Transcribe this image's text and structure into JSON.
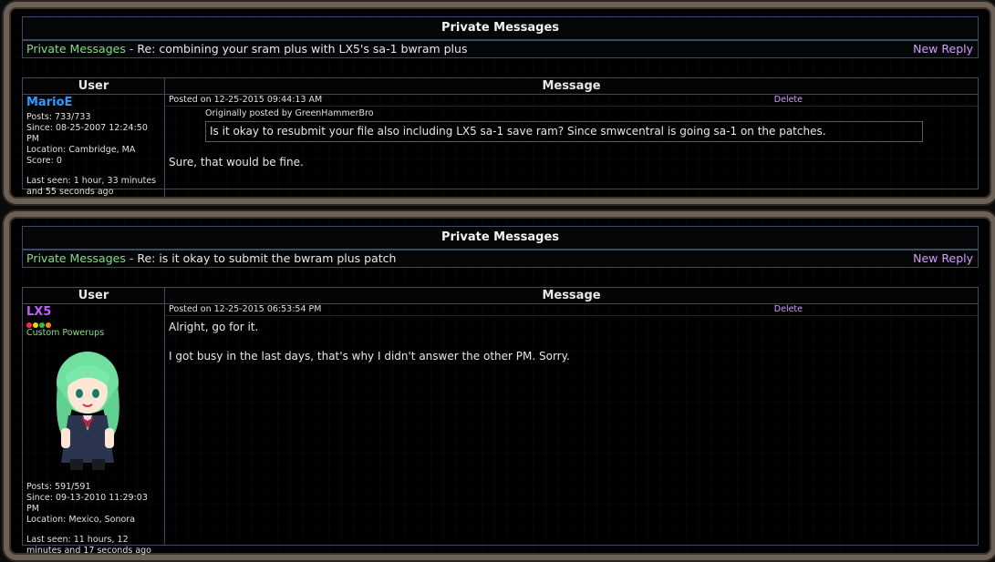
{
  "threads": [
    {
      "title": "Private Messages",
      "breadcrumb": {
        "link": "Private Messages",
        "separator": " - ",
        "subject": "Re: combining your sram plus with LX5's sa-1 bwram plus"
      },
      "new_reply": "New Reply",
      "headers": {
        "user": "User",
        "message": "Message"
      },
      "post": {
        "username": "MarioE",
        "posts": "Posts: 733/733",
        "since": "Since: 08-25-2007 12:24:50 PM",
        "location": "Location: Cambridge, MA",
        "score": "Score: 0",
        "last_seen": "Last seen: 1 hour, 33 minutes and 55 seconds ago",
        "posted_on": "Posted on 12-25-2015 09:44:13 AM",
        "delete": "Delete",
        "quote_header": "Originally posted by GreenHammerBro",
        "quote_text": "Is it okay to resubmit your file also including LX5 sa-1 save ram? Since smwcentral is going sa-1 on the patches.",
        "body": "Sure, that would be fine."
      }
    },
    {
      "title": "Private Messages",
      "breadcrumb": {
        "link": "Private Messages",
        "separator": " - ",
        "subject": "Re: is it okay to submit the bwram plus patch"
      },
      "new_reply": "New Reply",
      "headers": {
        "user": "User",
        "message": "Message"
      },
      "post": {
        "username": "LX5",
        "rank_dots": [
          "#ff3030",
          "#ffd400",
          "#30c030",
          "#ff8c00"
        ],
        "rank": "Custom Powerups",
        "avatar": "anime-character-avatar",
        "posts": "Posts: 591/591",
        "since": "Since: 09-13-2010 11:29:03 PM",
        "location": "Location: Mexico, Sonora",
        "last_seen": "Last seen: 11 hours, 12 minutes and 17 seconds ago",
        "posted_on": "Posted on 12-25-2015 06:53:54 PM",
        "delete": "Delete",
        "body_1": "Alright, go for it.",
        "body_2": "I got busy in the last days, that's why I didn't answer the other PM. Sorry."
      }
    }
  ]
}
